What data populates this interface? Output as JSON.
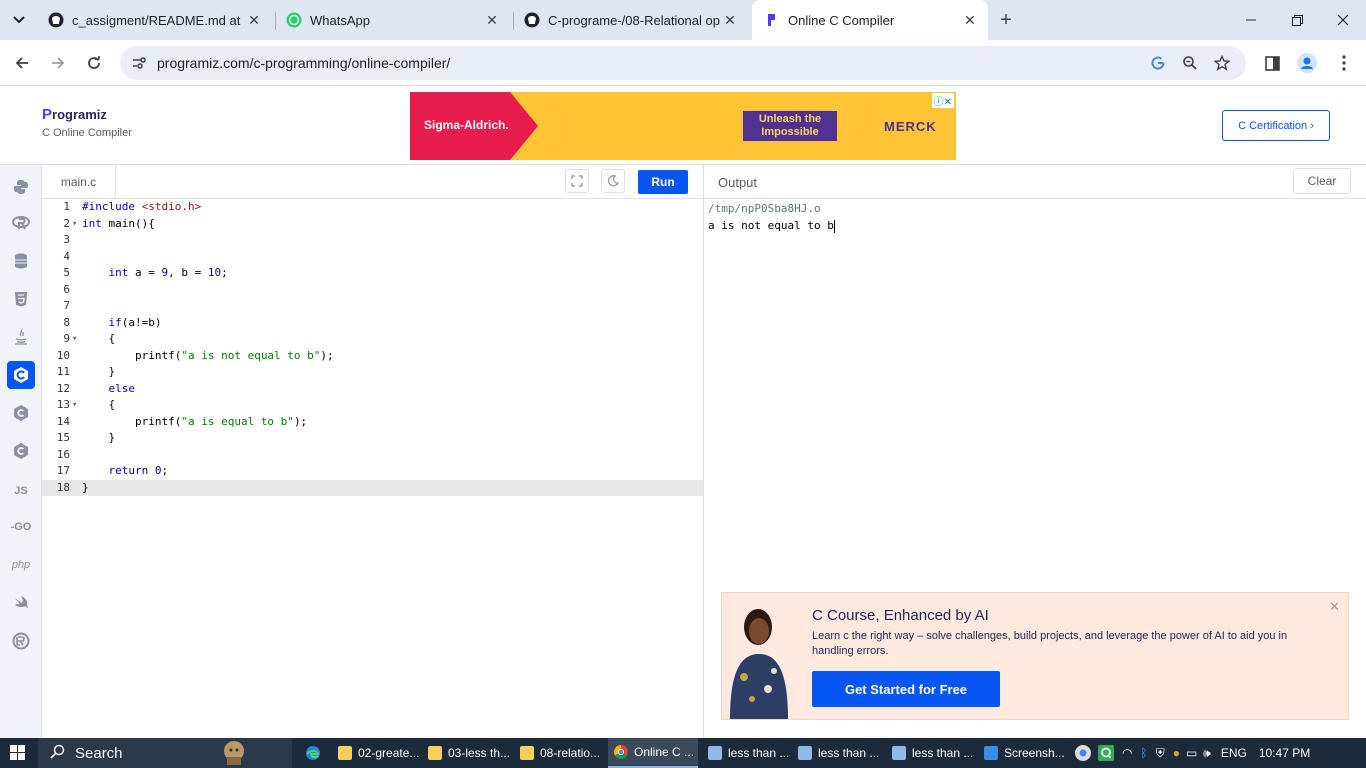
{
  "browser": {
    "tabs": [
      {
        "title": "c_assigment/README.md at m",
        "icon": "github-icon"
      },
      {
        "title": "WhatsApp",
        "icon": "whatsapp-icon"
      },
      {
        "title": "C-programe-/08-Relational op",
        "icon": "github-icon"
      },
      {
        "title": "Online C Compiler",
        "icon": "programiz-icon",
        "active": true
      }
    ],
    "url": "programiz.com/c-programming/online-compiler/"
  },
  "header": {
    "logo_p": "P",
    "logo_rest": "rogramiz",
    "logo_sub": "C Online Compiler",
    "certification_label": "C Certification ›"
  },
  "ad": {
    "brand_left": "Sigma-Aldrich.",
    "cta": "Unleash the Impossible",
    "brand_right": "MERCK"
  },
  "languages": [
    "python",
    "r",
    "sql",
    "html",
    "java",
    "c",
    "cpp",
    "csharp",
    "js",
    "go",
    "php",
    "swift",
    "rust"
  ],
  "editor": {
    "file_name": "main.c",
    "run_label": "Run",
    "current_line": 18
  },
  "output": {
    "title": "Output",
    "clear_label": "Clear",
    "path_line": "/tmp/npP0Sba8HJ.o",
    "result_line": "a is not equal to b"
  },
  "promo": {
    "title": "C Course, Enhanced by AI",
    "description": "Learn c the right way – solve challenges, build projects, and leverage the power of AI to aid you in handling errors.",
    "button_label": "Get Started for Free"
  },
  "taskbar": {
    "search_label": "Search",
    "apps": [
      {
        "label": "02-greate..."
      },
      {
        "label": "03-less th..."
      },
      {
        "label": "08-relatio..."
      },
      {
        "label": "Online C ..."
      },
      {
        "label": "less than ..."
      },
      {
        "label": "less than ..."
      },
      {
        "label": "less than ..."
      },
      {
        "label": "Screensh..."
      }
    ],
    "language": "ENG",
    "time": "10:47 PM"
  },
  "colors": {
    "accent": "#0556f3",
    "tabstrip": "#dfe6f3",
    "promo_bg": "#fde9dd"
  }
}
